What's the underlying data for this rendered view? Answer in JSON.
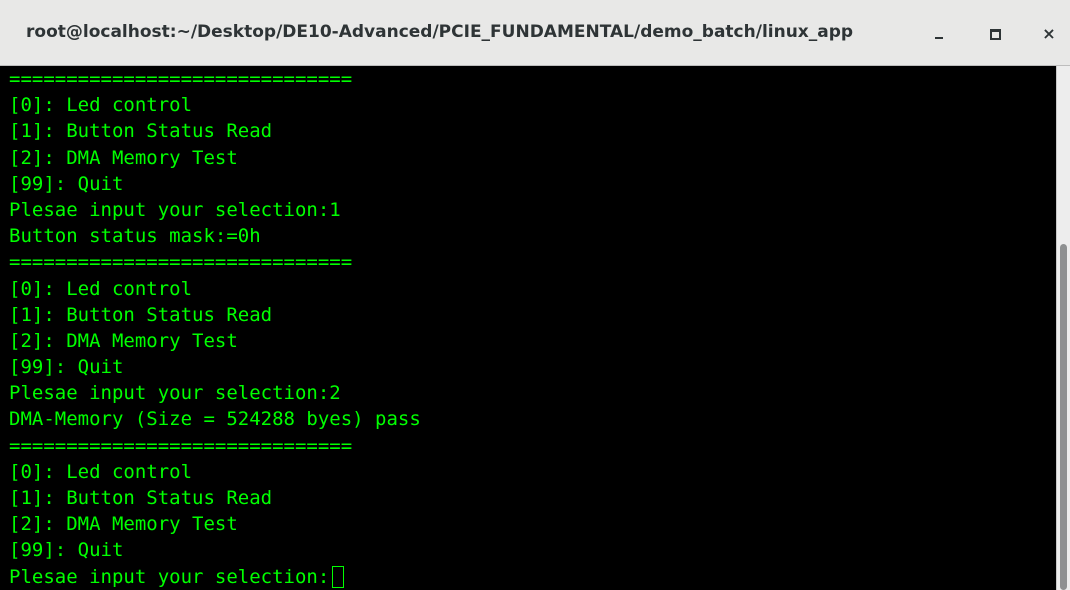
{
  "window": {
    "title": "root@localhost:~/Desktop/DE10-Advanced/PCIE_FUNDAMENTAL/demo_batch/linux_app",
    "close_glyph": "×"
  },
  "terminal": {
    "lines": [
      "==============================",
      "[0]: Led control",
      "[1]: Button Status Read",
      "[2]: DMA Memory Test",
      "[99]: Quit",
      "Plesae input your selection:1",
      "Button status mask:=0h",
      "==============================",
      "[0]: Led control",
      "[1]: Button Status Read",
      "[2]: DMA Memory Test",
      "[99]: Quit",
      "Plesae input your selection:2",
      "DMA-Memory (Size = 524288 byes) pass",
      "==============================",
      "[0]: Led control",
      "[1]: Button Status Read",
      "[2]: DMA Memory Test",
      "[99]: Quit"
    ],
    "prompt": "Plesae input your selection:",
    "text_color": "#00ff00",
    "background_color": "#000000"
  },
  "icons": {
    "minimize": "minimize-icon",
    "maximize": "maximize-icon",
    "close": "close-icon"
  }
}
